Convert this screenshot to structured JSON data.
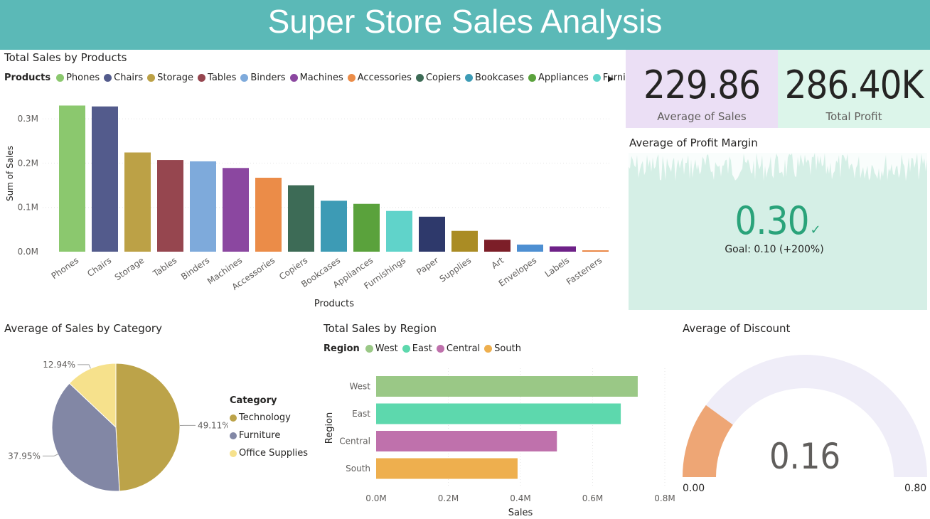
{
  "header": {
    "title": "Super Store Sales Analysis"
  },
  "colors": {
    "banner": "#5bb9b7",
    "kpi_left_bg": "#ebdff5",
    "kpi_right_bg": "#dcf5ea",
    "profit_margin_bg": "#d5efe6",
    "profit_margin_value": "#2aa37a",
    "gauge_fill": "#eea675",
    "gauge_track": "#efedf8"
  },
  "products_chart": {
    "title": "Total Sales by Products",
    "legend_title": "Products",
    "legend_items": [
      "Phones",
      "Chairs",
      "Storage",
      "Tables",
      "Binders",
      "Machines",
      "Accessories",
      "Copiers",
      "Bookcases",
      "Appliances",
      "Furnishin..."
    ],
    "legend_more": "▶"
  },
  "kpis": {
    "avg_sales": {
      "value": "229.86",
      "label": "Average of Sales"
    },
    "total_profit": {
      "value": "286.40K",
      "label": "Total Profit"
    }
  },
  "profit_margin": {
    "title": "Average of Profit Margin",
    "value": "0.30",
    "check_icon": "checkmark-icon",
    "goal": "Goal: 0.10 (+200%)"
  },
  "category_chart": {
    "title": "Average of Sales by Category",
    "legend_title": "Category"
  },
  "region_chart": {
    "title": "Total Sales by Region",
    "legend_title": "Region"
  },
  "discount_gauge": {
    "title": "Average of Discount",
    "value": 0.16,
    "value_label": "0.16",
    "min_label": "0.00",
    "max_label": "0.80",
    "min": 0,
    "max": 0.8
  },
  "chart_data": [
    {
      "type": "bar",
      "title": "Total Sales by Products",
      "xlabel": "Products",
      "ylabel": "Sum of Sales",
      "ylim": [
        0,
        0.35
      ],
      "yticks": [
        "0.0M",
        "0.1M",
        "0.2M",
        "0.3M"
      ],
      "categories": [
        "Phones",
        "Chairs",
        "Storage",
        "Tables",
        "Binders",
        "Machines",
        "Accessories",
        "Copiers",
        "Bookcases",
        "Appliances",
        "Furnishings",
        "Paper",
        "Supplies",
        "Art",
        "Envelopes",
        "Labels",
        "Fasteners"
      ],
      "values": [
        0.33,
        0.328,
        0.224,
        0.207,
        0.204,
        0.189,
        0.167,
        0.15,
        0.115,
        0.108,
        0.092,
        0.079,
        0.047,
        0.027,
        0.016,
        0.012,
        0.003
      ],
      "colors": [
        "#8bc86e",
        "#535b8c",
        "#bca146",
        "#96464f",
        "#7eaadb",
        "#8b47a0",
        "#eb8c48",
        "#3d6b56",
        "#3d9bb5",
        "#5aa23c",
        "#60d3ca",
        "#2e396b",
        "#aa8c24",
        "#7c1e28",
        "#4d8fd2",
        "#6e2188",
        "#e97f3b"
      ],
      "grid": true,
      "legend": "top"
    },
    {
      "type": "pie",
      "title": "Average of Sales by Category",
      "categories": [
        "Technology",
        "Furniture",
        "Office Supplies"
      ],
      "values": [
        49.11,
        37.95,
        12.94
      ],
      "labels": [
        "49.11%",
        "37.95%",
        "12.94%"
      ],
      "colors": [
        "#bca349",
        "#8287a5",
        "#f6e18c"
      ],
      "legend": "right"
    },
    {
      "type": "bar",
      "orientation": "horizontal",
      "title": "Total Sales by Region",
      "xlabel": "Sales",
      "ylabel": "Region",
      "xlim": [
        0,
        0.8
      ],
      "xticks": [
        "0.0M",
        "0.2M",
        "0.4M",
        "0.6M",
        "0.8M"
      ],
      "categories": [
        "West",
        "East",
        "Central",
        "South"
      ],
      "values": [
        0.725,
        0.678,
        0.501,
        0.392
      ],
      "colors": [
        "#9ac886",
        "#5dd8ad",
        "#bf71ac",
        "#eeaf4e"
      ],
      "grid": true,
      "legend": "top"
    }
  ]
}
